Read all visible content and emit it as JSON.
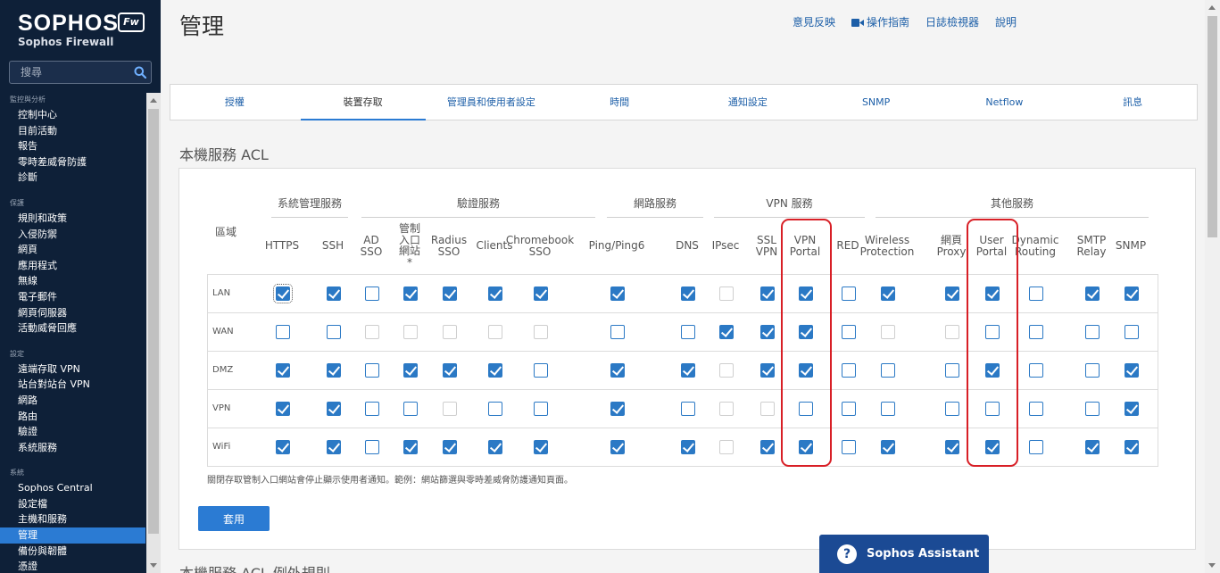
{
  "sidebar": {
    "brand": "SOPHOS",
    "badge": "Fw",
    "product": "Sophos Firewall",
    "search_placeholder": "搜尋",
    "groups": [
      {
        "heading": "監控與分析",
        "items": [
          "控制中心",
          "目前活動",
          "報告",
          "零時差威脅防護",
          "診斷"
        ]
      },
      {
        "heading": "保護",
        "items": [
          "規則和政策",
          "入侵防禦",
          "網頁",
          "應用程式",
          "無線",
          "電子郵件",
          "網頁伺服器",
          "活動威脅回應"
        ]
      },
      {
        "heading": "設定",
        "items": [
          "遠端存取 VPN",
          "站台對站台 VPN",
          "網路",
          "路由",
          "驗證",
          "系統服務"
        ]
      },
      {
        "heading": "系統",
        "items": [
          "Sophos Central",
          "設定檔",
          "主機和服務",
          "管理",
          "備份與韌體",
          "憑證"
        ]
      }
    ],
    "active_item": "管理"
  },
  "header": {
    "title": "管理",
    "links": [
      {
        "label": "意見反映",
        "icon": ""
      },
      {
        "label": "操作指南",
        "icon": "video-icon"
      },
      {
        "label": "日誌檢視器",
        "icon": ""
      },
      {
        "label": "說明",
        "icon": ""
      }
    ]
  },
  "tabs": [
    {
      "label": "授權",
      "active": false
    },
    {
      "label": "裝置存取",
      "active": true
    },
    {
      "label": "管理員和使用者設定",
      "active": false
    },
    {
      "label": "時間",
      "active": false
    },
    {
      "label": "通知設定",
      "active": false
    },
    {
      "label": "SNMP",
      "active": false
    },
    {
      "label": "Netflow",
      "active": false
    },
    {
      "label": "訊息",
      "active": false
    }
  ],
  "acl": {
    "section_title": "本機服務 ACL",
    "zone_label": "區域",
    "groups": [
      "系統管理服務",
      "驗證服務",
      "網路服務",
      "VPN 服務",
      "其他服務"
    ],
    "columns": [
      "HTTPS",
      "SSH",
      "AD\nSSO",
      "管制\n入口\n網站\n*",
      "Radius\nSSO",
      "Clients",
      "Chromebook\nSSO",
      "Ping/Ping6",
      "DNS",
      "IPsec",
      "SSL\nVPN",
      "VPN\nPortal",
      "RED",
      "Wireless\nProtection",
      "網頁\nProxy",
      "User\nPortal",
      "Dynamic\nRouting",
      "SMTP\nRelay",
      "SNMP"
    ],
    "rows": [
      {
        "zone": "LAN",
        "states": [
          "c",
          "c",
          "u",
          "c",
          "c",
          "c",
          "c",
          "c",
          "c",
          "d",
          "c",
          "c",
          "u",
          "c",
          "c",
          "c",
          "u",
          "c",
          "c"
        ]
      },
      {
        "zone": "WAN",
        "states": [
          "u",
          "u",
          "d",
          "d",
          "d",
          "d",
          "d",
          "u",
          "u",
          "c",
          "c",
          "c",
          "u",
          "d",
          "d",
          "u",
          "u",
          "u",
          "u"
        ]
      },
      {
        "zone": "DMZ",
        "states": [
          "c",
          "c",
          "u",
          "c",
          "c",
          "c",
          "u",
          "c",
          "c",
          "d",
          "c",
          "c",
          "u",
          "u",
          "u",
          "c",
          "u",
          "u",
          "c"
        ]
      },
      {
        "zone": "VPN",
        "states": [
          "c",
          "c",
          "u",
          "u",
          "d",
          "u",
          "u",
          "c",
          "u",
          "d",
          "d",
          "u",
          "u",
          "u",
          "u",
          "u",
          "u",
          "u",
          "c"
        ]
      },
      {
        "zone": "WiFi",
        "states": [
          "c",
          "c",
          "u",
          "c",
          "c",
          "c",
          "c",
          "c",
          "c",
          "d",
          "c",
          "c",
          "u",
          "c",
          "c",
          "c",
          "u",
          "c",
          "c"
        ]
      }
    ],
    "note": "關閉存取管制入口網站會停止顯示使用者通知。範例：網站篩選與零時差威脅防護通知頁面。",
    "apply_label": "套用",
    "next_section": "本機服務 ACL 例外規則"
  },
  "assistant": {
    "label": "Sophos Assistant",
    "icon": "question-icon"
  },
  "colors": {
    "accent": "#2b7bd3",
    "sidebar": "#0e2038",
    "highlight": "#d81f26",
    "checkbox": "#2b79c5"
  }
}
